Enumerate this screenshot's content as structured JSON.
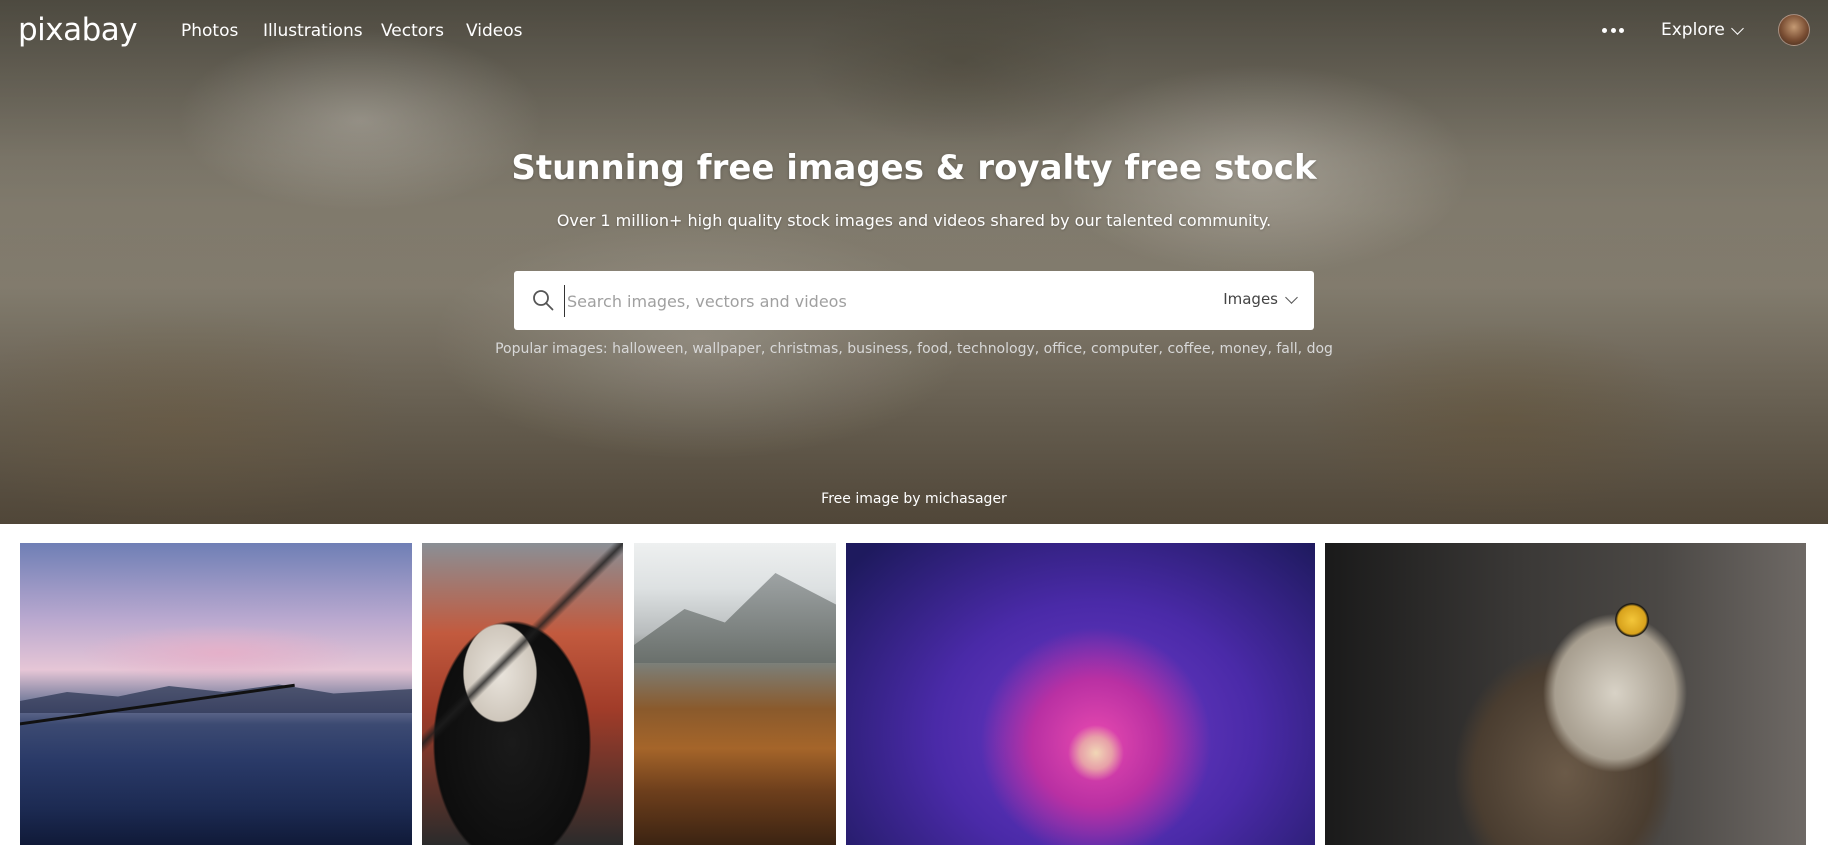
{
  "brand": {
    "logo_text": "pixabay"
  },
  "nav": {
    "links": [
      "Photos",
      "Illustrations",
      "Vectors",
      "Videos"
    ],
    "explore_label": "Explore"
  },
  "hero": {
    "title": "Stunning free images & royalty free stock",
    "subtitle": "Over 1 million+ high quality stock images and videos shared by our talented community.",
    "credit": "Free image by michasager"
  },
  "search": {
    "placeholder": "Search images, vectors and videos",
    "value": "",
    "type_selected": "Images"
  },
  "popular": {
    "label": "Popular images:",
    "tags": [
      "halloween",
      "wallpaper",
      "christmas",
      "business",
      "food",
      "technology",
      "office",
      "computer",
      "coffee",
      "money",
      "fall",
      "dog"
    ]
  },
  "gallery": {
    "tiles": [
      {
        "subject": "lake-sunset-with-branches"
      },
      {
        "subject": "masked-person-hoodie"
      },
      {
        "subject": "autumn-mountain-forest"
      },
      {
        "subject": "pink-purple-flower-closeup"
      },
      {
        "subject": "owl-portrait"
      }
    ]
  },
  "icons": {
    "search": "search-icon",
    "more": "more-dots-icon",
    "chevron": "chevron-down-icon"
  }
}
